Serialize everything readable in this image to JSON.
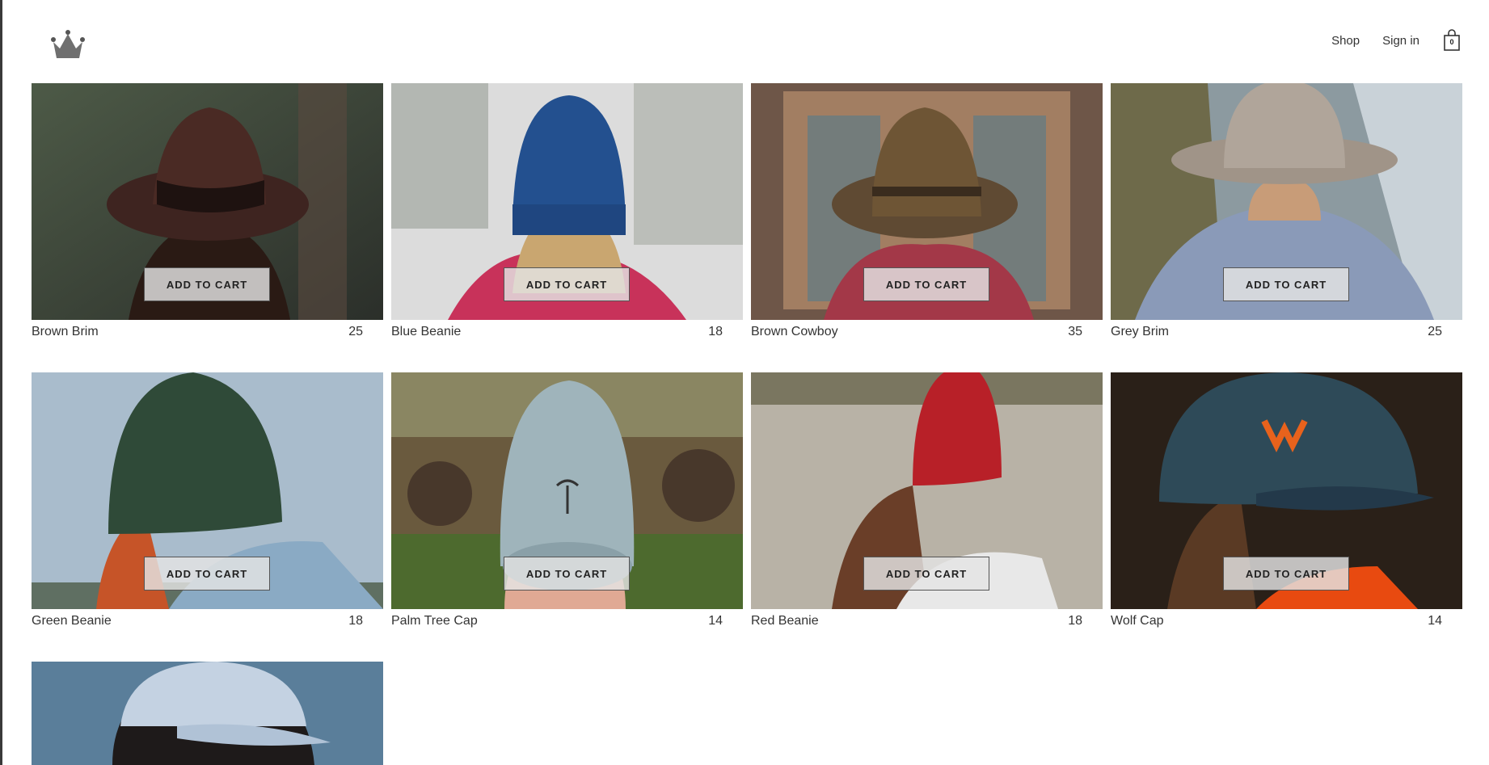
{
  "header": {
    "logo_icon": "crown-icon",
    "nav": {
      "shop": "Shop",
      "sign_in": "Sign in"
    },
    "cart": {
      "icon": "shopping-bag-icon",
      "count": "0"
    }
  },
  "button_label": "ADD TO CART",
  "products": [
    {
      "name": "Brown Brim",
      "price": "25"
    },
    {
      "name": "Blue Beanie",
      "price": "18"
    },
    {
      "name": "Brown Cowboy",
      "price": "35"
    },
    {
      "name": "Grey Brim",
      "price": "25"
    },
    {
      "name": "Green Beanie",
      "price": "18"
    },
    {
      "name": "Palm Tree Cap",
      "price": "14"
    },
    {
      "name": "Red Beanie",
      "price": "18"
    },
    {
      "name": "Wolf Cap",
      "price": "14"
    },
    {
      "name": "",
      "price": ""
    }
  ],
  "colors": {
    "text": "#333333",
    "button_bg": "#e4e4e4",
    "border": "#555555"
  }
}
